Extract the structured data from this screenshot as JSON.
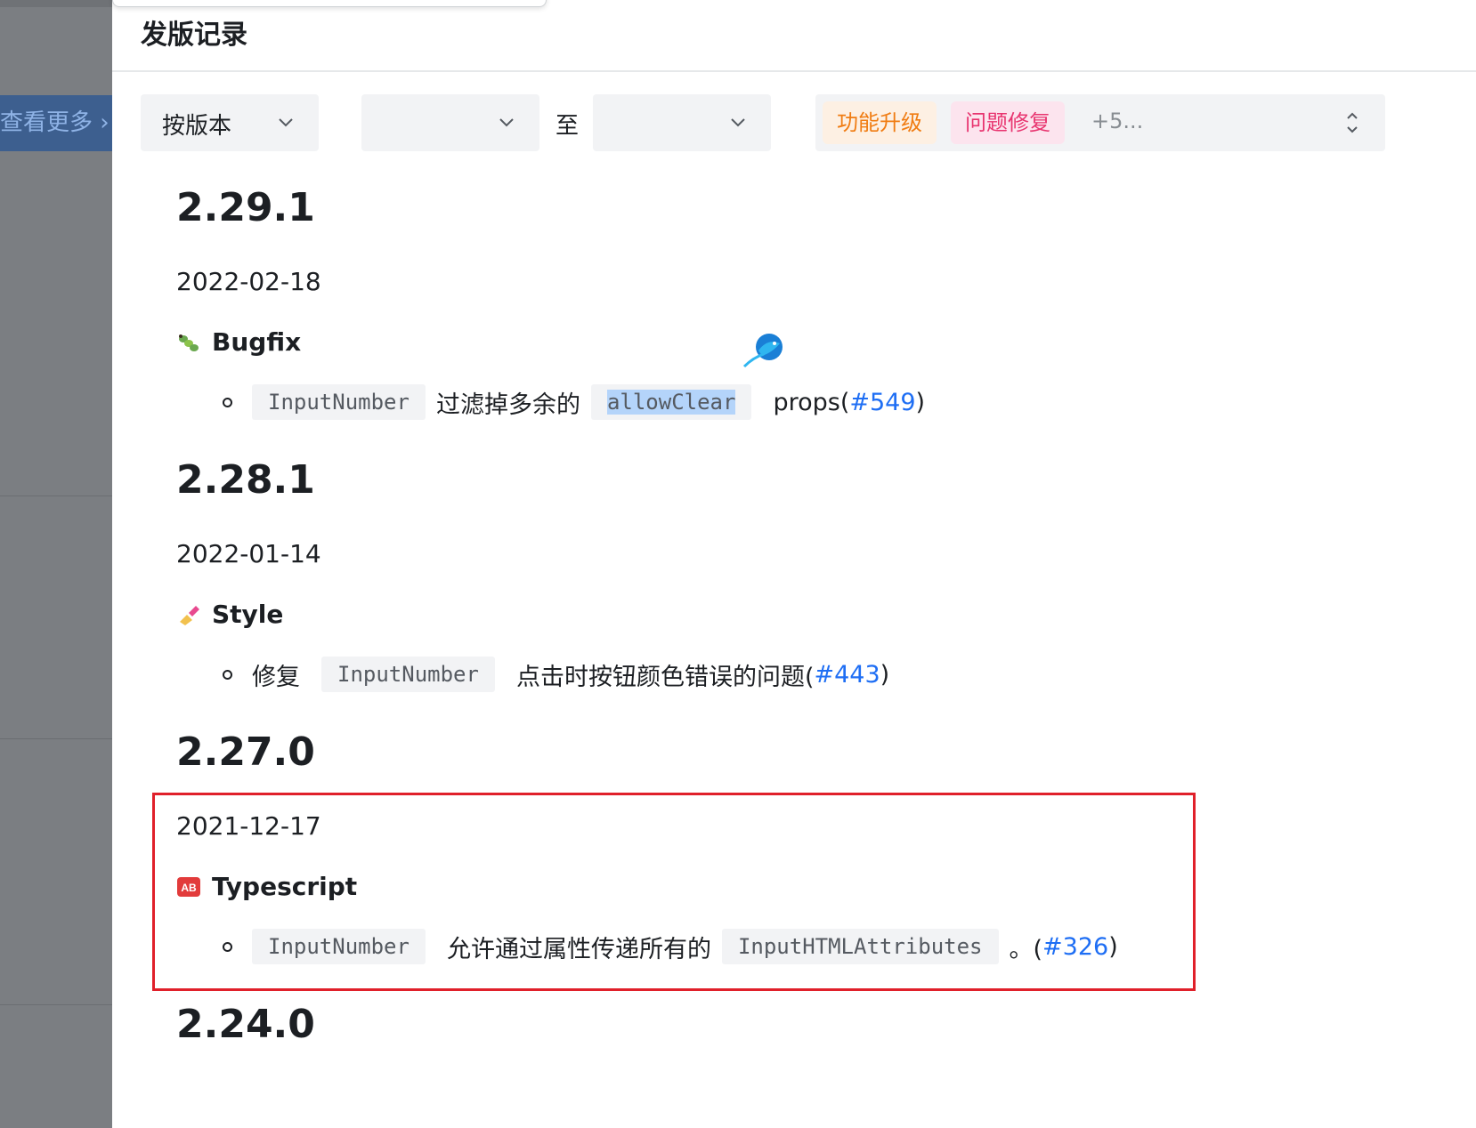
{
  "sidebar": {
    "more_label": "查看更多 ›"
  },
  "page": {
    "title": "发版记录"
  },
  "filters": {
    "mode_select": {
      "value": "按版本"
    },
    "from_select": {
      "value": ""
    },
    "to_label": "至",
    "to_select": {
      "value": ""
    },
    "type_select": {
      "tags": [
        "功能升级",
        "问题修复"
      ],
      "more": "+5..."
    }
  },
  "releases": [
    {
      "version": "2.29.1",
      "date": "2022-02-18",
      "category": "Bugfix",
      "category_icon": "bug-icon",
      "item": {
        "code1": "InputNumber",
        "text1": "过滤掉多余的",
        "code2": "allowClear",
        "text2": "props(",
        "link": "#549",
        "tail": ")"
      }
    },
    {
      "version": "2.28.1",
      "date": "2022-01-14",
      "category": "Style",
      "category_icon": "nail-polish-icon",
      "item": {
        "prefix": "修复",
        "code1": "InputNumber",
        "text1": "点击时按钮颜色错误的问题(",
        "link": "#443",
        "tail": ")"
      }
    },
    {
      "version": "2.27.0",
      "date": "2021-12-17",
      "category": "Typescript",
      "category_icon": "ab-badge-icon",
      "item": {
        "code1": "InputNumber",
        "text1": "允许通过属性传递所有的",
        "code2": "InputHTMLAttributes",
        "text2": "。(",
        "link": "#326",
        "tail": ")"
      }
    },
    {
      "version": "2.24.0"
    }
  ],
  "colors": {
    "accent": "#1e6ef4",
    "highlight_border": "#e0202a",
    "tag_orange": "#f07c12",
    "tag_pink": "#e8346f"
  }
}
